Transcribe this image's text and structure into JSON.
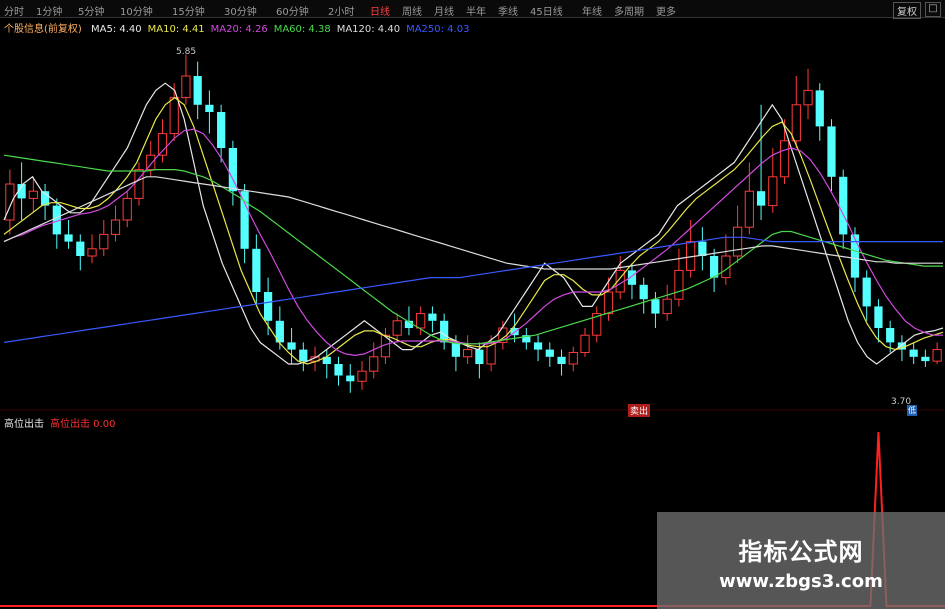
{
  "toolbar": {
    "tabs": [
      "分时",
      "1分钟",
      "5分钟",
      "10分钟",
      "15分钟",
      "30分钟",
      "60分钟",
      "2小时",
      "日线",
      "周线",
      "月线",
      "半年",
      "季线",
      "45日线",
      "年线",
      "多周期",
      "更多"
    ],
    "active_tab": "日线",
    "right_button": "复权",
    "window_button": "□"
  },
  "ma_legend": {
    "prefix": "个股信息(前复权)",
    "items": [
      {
        "label": "MA5: 4.40",
        "color": "#e8e8e8"
      },
      {
        "label": "MA10: 4.41",
        "color": "#e8e84a"
      },
      {
        "label": "MA20: 4.26",
        "color": "#d04adf"
      },
      {
        "label": "MA60: 4.38",
        "color": "#4ad84a"
      },
      {
        "label": "MA120: 4.40",
        "color": "#dcdcdc"
      },
      {
        "label": "MA250: 4.03",
        "color": "#3a58ff"
      }
    ]
  },
  "price_labels": {
    "high": "5.85",
    "low": "3.70"
  },
  "sub_legend": {
    "items": [
      {
        "label": "高位出击",
        "color": "#e8e8e8"
      },
      {
        "label": "高位出击 0.00",
        "color": "#ff3030"
      }
    ],
    "signal_badge": "卖出",
    "low_badge": "低"
  },
  "watermark": {
    "title": "指标公式网",
    "url": "www.zbgs3.com"
  },
  "chart_data": {
    "type": "line",
    "x_range": [
      1,
      100
    ],
    "series": [
      {
        "name": "MA5",
        "color": "#e8e8e8",
        "values": [
          4.7,
          4.85,
          4.95,
          5.0,
          4.9,
          4.85,
          4.8,
          4.75,
          4.75,
          4.8,
          4.9,
          5.0,
          5.1,
          5.2,
          5.35,
          5.5,
          5.6,
          5.65,
          5.6,
          5.4,
          5.1,
          4.8,
          4.6,
          4.4,
          4.25,
          4.1,
          3.95,
          3.85,
          3.8,
          3.75,
          3.7,
          3.7,
          3.72,
          3.75,
          3.8,
          3.85,
          3.9,
          3.95,
          4.0,
          3.95,
          3.9,
          3.85,
          3.8,
          3.8,
          3.85,
          3.9,
          3.92,
          3.88,
          3.85,
          3.82,
          3.8,
          3.85,
          3.9,
          4.0,
          4.1,
          4.2,
          4.3,
          4.4,
          4.35,
          4.3,
          4.2,
          4.1,
          4.1,
          4.2,
          4.3,
          4.4,
          4.45,
          4.5,
          4.55,
          4.6,
          4.7,
          4.8,
          4.85,
          4.9,
          4.95,
          5.0,
          5.05,
          5.1,
          5.2,
          5.3,
          5.4,
          5.5,
          5.4,
          5.2,
          5.0,
          4.8,
          4.6,
          4.4,
          4.2,
          4.0,
          3.85,
          3.75,
          3.7,
          3.75,
          3.8,
          3.85,
          3.9,
          3.92,
          3.93,
          3.95
        ]
      },
      {
        "name": "MA10",
        "color": "#e8e84a",
        "values": [
          4.6,
          4.65,
          4.7,
          4.75,
          4.8,
          4.82,
          4.82,
          4.8,
          4.78,
          4.78,
          4.8,
          4.85,
          4.92,
          5.0,
          5.1,
          5.25,
          5.4,
          5.5,
          5.55,
          5.5,
          5.35,
          5.15,
          4.95,
          4.75,
          4.55,
          4.35,
          4.2,
          4.05,
          3.95,
          3.85,
          3.78,
          3.72,
          3.7,
          3.72,
          3.75,
          3.8,
          3.85,
          3.9,
          3.93,
          3.93,
          3.9,
          3.88,
          3.85,
          3.82,
          3.82,
          3.85,
          3.87,
          3.87,
          3.85,
          3.83,
          3.82,
          3.82,
          3.85,
          3.9,
          3.98,
          4.08,
          4.18,
          4.28,
          4.32,
          4.32,
          4.28,
          4.22,
          4.18,
          4.18,
          4.22,
          4.3,
          4.38,
          4.45,
          4.5,
          4.55,
          4.62,
          4.7,
          4.78,
          4.85,
          4.9,
          4.95,
          5.0,
          5.05,
          5.12,
          5.2,
          5.28,
          5.35,
          5.38,
          5.3,
          5.15,
          4.98,
          4.8,
          4.62,
          4.45,
          4.28,
          4.12,
          3.98,
          3.88,
          3.82,
          3.8,
          3.82,
          3.85,
          3.88,
          3.9,
          3.92
        ]
      },
      {
        "name": "MA20",
        "color": "#d04adf",
        "values": [
          4.55,
          4.58,
          4.6,
          4.63,
          4.66,
          4.68,
          4.7,
          4.72,
          4.74,
          4.75,
          4.77,
          4.8,
          4.85,
          4.9,
          4.97,
          5.05,
          5.13,
          5.2,
          5.27,
          5.32,
          5.33,
          5.3,
          5.22,
          5.12,
          5.0,
          4.87,
          4.73,
          4.6,
          4.48,
          4.35,
          4.22,
          4.1,
          4.0,
          3.92,
          3.85,
          3.8,
          3.77,
          3.76,
          3.77,
          3.8,
          3.83,
          3.85,
          3.86,
          3.86,
          3.86,
          3.86,
          3.86,
          3.86,
          3.85,
          3.84,
          3.84,
          3.84,
          3.85,
          3.88,
          3.93,
          3.98,
          4.04,
          4.1,
          4.15,
          4.18,
          4.2,
          4.2,
          4.2,
          4.2,
          4.22,
          4.26,
          4.3,
          4.35,
          4.4,
          4.45,
          4.5,
          4.56,
          4.62,
          4.68,
          4.74,
          4.8,
          4.86,
          4.92,
          4.98,
          5.04,
          5.1,
          5.15,
          5.18,
          5.2,
          5.18,
          5.12,
          5.03,
          4.92,
          4.8,
          4.67,
          4.53,
          4.4,
          4.28,
          4.17,
          4.08,
          4.0,
          3.95,
          3.92,
          3.9,
          3.9
        ]
      },
      {
        "name": "MA60",
        "color": "#4ad84a",
        "values": [
          5.15,
          5.14,
          5.13,
          5.12,
          5.11,
          5.1,
          5.09,
          5.08,
          5.07,
          5.06,
          5.05,
          5.04,
          5.04,
          5.04,
          5.04,
          5.04,
          5.05,
          5.05,
          5.05,
          5.04,
          5.02,
          5.0,
          4.97,
          4.93,
          4.89,
          4.85,
          4.8,
          4.76,
          4.71,
          4.66,
          4.61,
          4.56,
          4.51,
          4.46,
          4.41,
          4.36,
          4.31,
          4.26,
          4.21,
          4.16,
          4.11,
          4.06,
          4.02,
          3.98,
          3.94,
          3.9,
          3.87,
          3.85,
          3.84,
          3.84,
          3.84,
          3.85,
          3.86,
          3.87,
          3.88,
          3.89,
          3.9,
          3.92,
          3.94,
          3.96,
          3.98,
          4.0,
          4.02,
          4.04,
          4.06,
          4.08,
          4.1,
          4.12,
          4.14,
          4.16,
          4.18,
          4.2,
          4.22,
          4.25,
          4.28,
          4.31,
          4.35,
          4.4,
          4.45,
          4.5,
          4.55,
          4.6,
          4.62,
          4.62,
          4.6,
          4.58,
          4.56,
          4.54,
          4.52,
          4.5,
          4.48,
          4.46,
          4.44,
          4.42,
          4.41,
          4.4,
          4.39,
          4.38,
          4.38,
          4.38
        ]
      },
      {
        "name": "MA120",
        "color": "#dcdcdc",
        "values": [
          4.55,
          4.58,
          4.61,
          4.64,
          4.67,
          4.7,
          4.73,
          4.76,
          4.79,
          4.82,
          4.85,
          4.88,
          4.91,
          4.94,
          4.97,
          5.0,
          5.0,
          4.99,
          4.98,
          4.97,
          4.96,
          4.95,
          4.94,
          4.93,
          4.92,
          4.91,
          4.9,
          4.89,
          4.88,
          4.87,
          4.86,
          4.84,
          4.82,
          4.8,
          4.78,
          4.76,
          4.74,
          4.72,
          4.7,
          4.68,
          4.66,
          4.64,
          4.62,
          4.6,
          4.58,
          4.56,
          4.54,
          4.52,
          4.5,
          4.48,
          4.46,
          4.44,
          4.42,
          4.4,
          4.39,
          4.38,
          4.37,
          4.36,
          4.36,
          4.36,
          4.36,
          4.36,
          4.36,
          4.36,
          4.36,
          4.37,
          4.38,
          4.39,
          4.4,
          4.41,
          4.42,
          4.43,
          4.44,
          4.45,
          4.46,
          4.47,
          4.48,
          4.49,
          4.5,
          4.51,
          4.52,
          4.52,
          4.51,
          4.5,
          4.49,
          4.48,
          4.47,
          4.46,
          4.45,
          4.44,
          4.43,
          4.42,
          4.41,
          4.41,
          4.4,
          4.4,
          4.4,
          4.4,
          4.4,
          4.4
        ]
      },
      {
        "name": "MA250",
        "color": "#3a58ff",
        "values": [
          3.85,
          3.86,
          3.87,
          3.88,
          3.89,
          3.9,
          3.91,
          3.92,
          3.93,
          3.94,
          3.95,
          3.96,
          3.97,
          3.98,
          3.99,
          4.0,
          4.01,
          4.02,
          4.03,
          4.04,
          4.05,
          4.06,
          4.07,
          4.08,
          4.09,
          4.1,
          4.11,
          4.12,
          4.13,
          4.14,
          4.15,
          4.16,
          4.17,
          4.18,
          4.19,
          4.2,
          4.21,
          4.22,
          4.23,
          4.24,
          4.25,
          4.26,
          4.27,
          4.28,
          4.29,
          4.3,
          4.3,
          4.3,
          4.3,
          4.31,
          4.32,
          4.33,
          4.34,
          4.35,
          4.36,
          4.37,
          4.38,
          4.39,
          4.4,
          4.41,
          4.42,
          4.43,
          4.44,
          4.45,
          4.46,
          4.47,
          4.48,
          4.49,
          4.5,
          4.51,
          4.52,
          4.53,
          4.54,
          4.55,
          4.56,
          4.57,
          4.58,
          4.58,
          4.58,
          4.57,
          4.56,
          4.55,
          4.55,
          4.55,
          4.55,
          4.55,
          4.55,
          4.55,
          4.55,
          4.55,
          4.55,
          4.55,
          4.55,
          4.55,
          4.55,
          4.55,
          4.55,
          4.55,
          4.55,
          4.55
        ]
      }
    ],
    "candles": [
      [
        4.7,
        4.95,
        5.05,
        4.6
      ],
      [
        4.95,
        4.85,
        5.1,
        4.7
      ],
      [
        4.85,
        4.9,
        5.0,
        4.75
      ],
      [
        4.9,
        4.8,
        4.95,
        4.7
      ],
      [
        4.8,
        4.6,
        4.85,
        4.5
      ],
      [
        4.6,
        4.55,
        4.7,
        4.5
      ],
      [
        4.55,
        4.45,
        4.6,
        4.35
      ],
      [
        4.45,
        4.5,
        4.6,
        4.4
      ],
      [
        4.5,
        4.6,
        4.7,
        4.45
      ],
      [
        4.6,
        4.7,
        4.8,
        4.55
      ],
      [
        4.7,
        4.85,
        4.9,
        4.65
      ],
      [
        4.85,
        5.05,
        5.1,
        4.8
      ],
      [
        5.05,
        5.15,
        5.25,
        5.0
      ],
      [
        5.15,
        5.3,
        5.4,
        5.1
      ],
      [
        5.3,
        5.55,
        5.65,
        5.25
      ],
      [
        5.55,
        5.7,
        5.85,
        5.5
      ],
      [
        5.7,
        5.5,
        5.8,
        5.4
      ],
      [
        5.5,
        5.45,
        5.6,
        5.3
      ],
      [
        5.45,
        5.2,
        5.5,
        5.1
      ],
      [
        5.2,
        4.9,
        5.25,
        4.8
      ],
      [
        4.9,
        4.5,
        4.95,
        4.4
      ],
      [
        4.5,
        4.2,
        4.6,
        4.1
      ],
      [
        4.2,
        4.0,
        4.3,
        3.9
      ],
      [
        4.0,
        3.85,
        4.1,
        3.8
      ],
      [
        3.85,
        3.8,
        3.95,
        3.7
      ],
      [
        3.8,
        3.72,
        3.85,
        3.65
      ],
      [
        3.72,
        3.75,
        3.82,
        3.65
      ],
      [
        3.75,
        3.7,
        3.8,
        3.6
      ],
      [
        3.7,
        3.62,
        3.75,
        3.55
      ],
      [
        3.62,
        3.58,
        3.7,
        3.5
      ],
      [
        3.58,
        3.65,
        3.72,
        3.52
      ],
      [
        3.65,
        3.75,
        3.85,
        3.6
      ],
      [
        3.75,
        3.9,
        3.95,
        3.7
      ],
      [
        3.9,
        4.0,
        4.05,
        3.85
      ],
      [
        4.0,
        3.95,
        4.1,
        3.9
      ],
      [
        3.95,
        4.05,
        4.1,
        3.9
      ],
      [
        4.05,
        4.0,
        4.1,
        3.92
      ],
      [
        4.0,
        3.85,
        4.05,
        3.8
      ],
      [
        3.85,
        3.75,
        3.9,
        3.65
      ],
      [
        3.75,
        3.8,
        3.9,
        3.7
      ],
      [
        3.8,
        3.7,
        3.85,
        3.6
      ],
      [
        3.7,
        3.85,
        3.9,
        3.65
      ],
      [
        3.85,
        3.95,
        4.0,
        3.8
      ],
      [
        3.95,
        3.9,
        4.05,
        3.85
      ],
      [
        3.9,
        3.85,
        3.95,
        3.8
      ],
      [
        3.85,
        3.8,
        3.9,
        3.72
      ],
      [
        3.8,
        3.75,
        3.85,
        3.68
      ],
      [
        3.75,
        3.7,
        3.8,
        3.62
      ],
      [
        3.7,
        3.78,
        3.82,
        3.65
      ],
      [
        3.78,
        3.9,
        3.95,
        3.75
      ],
      [
        3.9,
        4.05,
        4.1,
        3.85
      ],
      [
        4.05,
        4.2,
        4.3,
        4.0
      ],
      [
        4.2,
        4.35,
        4.45,
        4.15
      ],
      [
        4.35,
        4.25,
        4.4,
        4.15
      ],
      [
        4.25,
        4.15,
        4.3,
        4.05
      ],
      [
        4.15,
        4.05,
        4.2,
        3.95
      ],
      [
        4.05,
        4.15,
        4.25,
        4.0
      ],
      [
        4.15,
        4.35,
        4.5,
        4.1
      ],
      [
        4.35,
        4.55,
        4.7,
        4.3
      ],
      [
        4.55,
        4.45,
        4.65,
        4.35
      ],
      [
        4.45,
        4.3,
        4.5,
        4.2
      ],
      [
        4.3,
        4.45,
        4.6,
        4.25
      ],
      [
        4.45,
        4.65,
        4.8,
        4.4
      ],
      [
        4.65,
        4.9,
        5.1,
        4.6
      ],
      [
        4.9,
        4.8,
        5.5,
        4.7
      ],
      [
        4.8,
        5.0,
        5.2,
        4.75
      ],
      [
        5.0,
        5.25,
        5.4,
        4.95
      ],
      [
        5.25,
        5.5,
        5.7,
        5.2
      ],
      [
        5.5,
        5.6,
        5.75,
        5.4
      ],
      [
        5.6,
        5.35,
        5.65,
        5.25
      ],
      [
        5.35,
        5.0,
        5.4,
        4.9
      ],
      [
        5.0,
        4.6,
        5.05,
        4.5
      ],
      [
        4.6,
        4.3,
        4.65,
        4.2
      ],
      [
        4.3,
        4.1,
        4.35,
        4.0
      ],
      [
        4.1,
        3.95,
        4.15,
        3.85
      ],
      [
        3.95,
        3.85,
        4.0,
        3.78
      ],
      [
        3.85,
        3.8,
        3.9,
        3.72
      ],
      [
        3.8,
        3.75,
        3.85,
        3.7
      ],
      [
        3.75,
        3.72,
        3.8,
        3.68
      ],
      [
        3.72,
        3.8,
        3.85,
        3.7
      ]
    ],
    "indicator": {
      "name": "高位出击",
      "spike_index": 74,
      "value": 0.0
    }
  }
}
